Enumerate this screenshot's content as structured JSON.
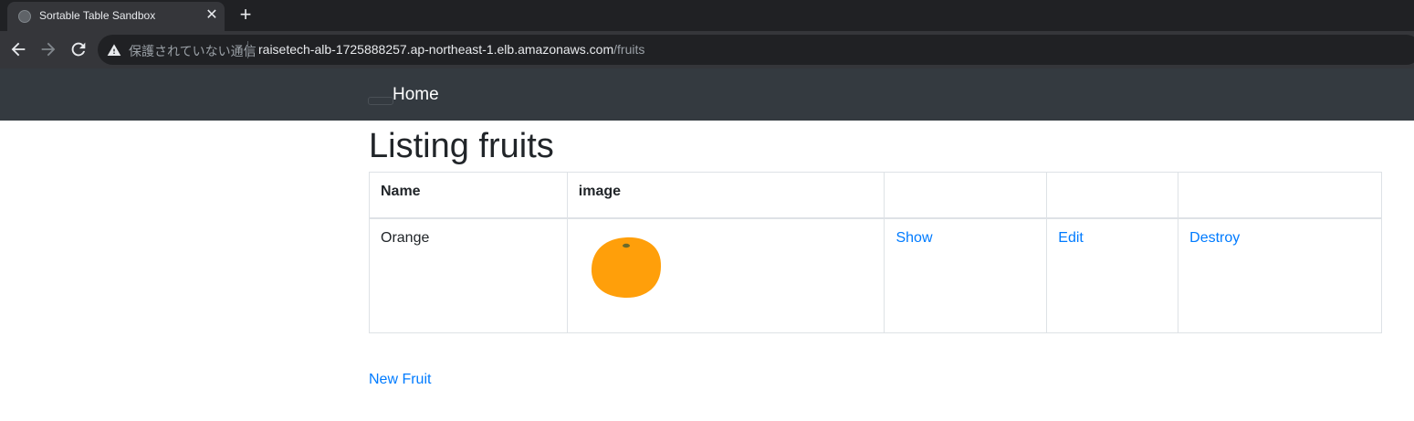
{
  "browser": {
    "tab": {
      "title": "Sortable Table Sandbox",
      "close_glyph": "✕",
      "icon": "globe-icon"
    },
    "new_tab_glyph": "+",
    "security_label": "保護されていない通信",
    "url_host": "raisetech-alb-1725888257.ap-northeast-1.elb.amazonaws.com",
    "url_path": "/fruits"
  },
  "navbar": {
    "brand": "Home"
  },
  "page": {
    "title": "Listing fruits",
    "table": {
      "headers": [
        "Name",
        "image",
        "",
        "",
        ""
      ],
      "rows": [
        {
          "name": "Orange",
          "image": "orange-image",
          "show": "Show",
          "edit": "Edit",
          "destroy": "Destroy"
        }
      ]
    },
    "new_link": "New Fruit"
  },
  "colors": {
    "navbar_bg": "#343a40",
    "link": "#007bff",
    "orange": "#ff9f0a"
  }
}
